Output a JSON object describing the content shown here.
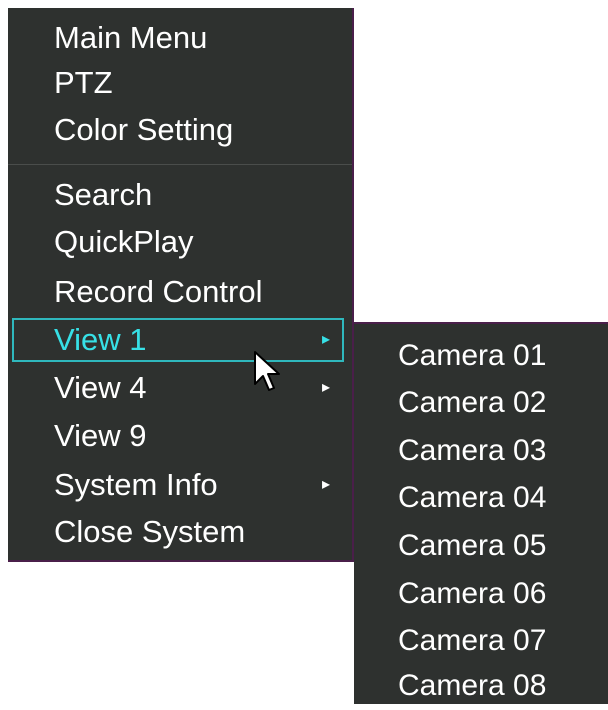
{
  "menu": {
    "group1": [
      {
        "label": "Main Menu"
      },
      {
        "label": "PTZ"
      },
      {
        "label": "Color Setting"
      }
    ],
    "group2": [
      {
        "label": "Search"
      },
      {
        "label": "QuickPlay"
      },
      {
        "label": "Record Control"
      },
      {
        "label": "View 1",
        "has_submenu": true,
        "selected": true
      },
      {
        "label": "View 4",
        "has_submenu": true
      },
      {
        "label": "View 9"
      },
      {
        "label": "System Info",
        "has_submenu": true
      },
      {
        "label": "Close System"
      }
    ],
    "submenu_arrow_glyph": "▸"
  },
  "submenu": {
    "items": [
      {
        "label": "Camera 01"
      },
      {
        "label": "Camera 02"
      },
      {
        "label": "Camera 03"
      },
      {
        "label": "Camera 04"
      },
      {
        "label": "Camera 05"
      },
      {
        "label": "Camera 06"
      },
      {
        "label": "Camera 07"
      },
      {
        "label": "Camera 08"
      }
    ]
  },
  "colors": {
    "menu_background": "#2e312f",
    "text": "#ffffff",
    "highlight_text": "#37e0e6",
    "highlight_border": "#2fb8bd",
    "menu_edge": "#4a1f4a"
  },
  "icons": {
    "cursor": "mouse-pointer-icon",
    "submenu_arrow": "chevron-right-icon"
  }
}
